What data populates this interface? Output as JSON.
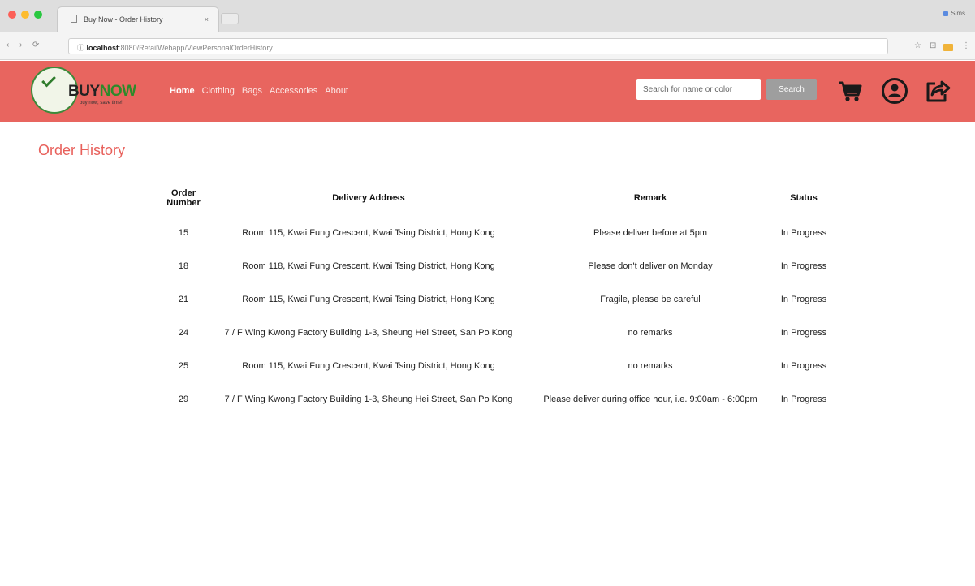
{
  "browser": {
    "tab_title": "Buy Now - Order History",
    "tab_close": "×",
    "profile": "Sims",
    "url_host": "localhost",
    "url_path": ":8080/RetailWebapp/ViewPersonalOrderHistory",
    "back": "‹",
    "forward": "›",
    "reload": "⟳",
    "info": "ⓘ",
    "star": "☆",
    "menu": "⋮"
  },
  "header": {
    "logo_buy": "BUY",
    "logo_now": "NOW",
    "logo_tagline": "buy now, save time!",
    "nav": [
      {
        "label": "Home"
      },
      {
        "label": "Clothing"
      },
      {
        "label": "Bags"
      },
      {
        "label": "Accessories"
      },
      {
        "label": "About"
      }
    ],
    "search_placeholder": "Search for name or color",
    "search_button": "Search"
  },
  "page": {
    "title": "Order History"
  },
  "table": {
    "headers": {
      "order_line1": "Order",
      "order_line2": "Number",
      "address": "Delivery Address",
      "remark": "Remark",
      "status": "Status"
    },
    "rows": [
      {
        "order_no": "15",
        "address": "Room 115, Kwai Fung Crescent, Kwai Tsing District, Hong Kong",
        "remark": "Please deliver before at 5pm",
        "status": "In Progress"
      },
      {
        "order_no": "18",
        "address": "Room 118, Kwai Fung Crescent, Kwai Tsing District, Hong Kong",
        "remark": "Please don't deliver on Monday",
        "status": "In Progress"
      },
      {
        "order_no": "21",
        "address": "Room 115, Kwai Fung Crescent, Kwai Tsing District, Hong Kong",
        "remark": "Fragile, please be careful",
        "status": "In Progress"
      },
      {
        "order_no": "24",
        "address": "7 / F Wing Kwong Factory Building 1-3, Sheung Hei Street, San Po Kong",
        "remark": "no remarks",
        "status": "In Progress"
      },
      {
        "order_no": "25",
        "address": "Room 115, Kwai Fung Crescent, Kwai Tsing District, Hong Kong",
        "remark": "no remarks",
        "status": "In Progress"
      },
      {
        "order_no": "29",
        "address": "7 / F Wing Kwong Factory Building 1-3, Sheung Hei Street, San Po Kong",
        "remark": "Please deliver during office hour, i.e. 9:00am - 6:00pm",
        "status": "In Progress"
      }
    ]
  }
}
